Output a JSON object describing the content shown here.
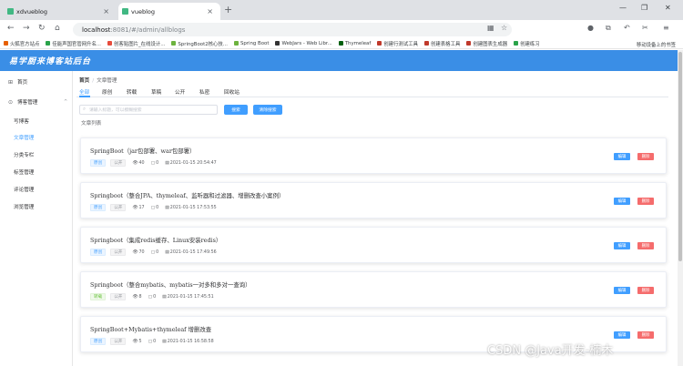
{
  "browser": {
    "tabs": [
      {
        "title": "xdvueblog",
        "active": false
      },
      {
        "title": "vueblog",
        "active": true
      }
    ],
    "url_host": "localhost",
    "url_path": ":8081/#/admin/allblogs",
    "bookmarks": [
      {
        "label": "火狐官方站点",
        "color": "#e66000"
      },
      {
        "label": "佳能声国官管网升名...",
        "color": "#2aa34a"
      },
      {
        "label": "创客贴图片_在线设计...",
        "color": "#e74c3c"
      },
      {
        "label": "SpringBoot2核心技...",
        "color": "#6db33f"
      },
      {
        "label": "Spring Boot",
        "color": "#6db33f"
      },
      {
        "label": "WebJars - Web Libr...",
        "color": "#333333"
      },
      {
        "label": "Thymeleaf",
        "color": "#005f0f"
      },
      {
        "label": "创建行测试工具",
        "color": "#c0392b"
      },
      {
        "label": "创建表格工具",
        "color": "#c0392b"
      },
      {
        "label": "创建图表生成器",
        "color": "#c0392b"
      },
      {
        "label": "创建练习",
        "color": "#2aa34a"
      }
    ],
    "bookmark_end": "移动设备上的书签"
  },
  "app": {
    "logo": "易学厨来博客站后台"
  },
  "sidebar": {
    "items": [
      {
        "label": "首页",
        "icon": "grid-icon",
        "glyph": "⊞",
        "type": "top"
      },
      {
        "label": "博客管理",
        "icon": "location-icon",
        "glyph": "⊙",
        "type": "group"
      },
      {
        "label": "写博客",
        "type": "sub",
        "active": false
      },
      {
        "label": "文章管理",
        "type": "sub",
        "active": true
      },
      {
        "label": "分类专栏",
        "type": "sub",
        "active": false
      },
      {
        "label": "标签管理",
        "type": "sub",
        "active": false
      },
      {
        "label": "评论管理",
        "type": "sub",
        "active": false
      },
      {
        "label": "浏览管理",
        "type": "sub",
        "active": false
      }
    ]
  },
  "breadcrumb": {
    "home": "首页",
    "separator": "/",
    "current": "文章管理"
  },
  "tabs": [
    "全部",
    "原创",
    "转载",
    "草稿",
    "公开",
    "私密",
    "回收站"
  ],
  "search": {
    "placeholder": "请输入标题，可以模糊搜索",
    "search_button": "搜索",
    "clear_button": "清除搜索"
  },
  "list_title": "文章列表",
  "edit_label": "编辑",
  "delete_label": "删除",
  "articles": [
    {
      "title": "SpringBoot（jar包部署、war包部署）",
      "category": "原创",
      "visibility": "公开",
      "views": "40",
      "comments": "0",
      "date": "2021-01-15 20:54:47"
    },
    {
      "title": "Springboot（整合JPA、thymeleaf、监听器和过滤器、增删改查小案例）",
      "category": "原创",
      "visibility": "公开",
      "views": "17",
      "comments": "0",
      "date": "2021-01-15 17:53:55"
    },
    {
      "title": "Springboot（集成redis缓存、Linux安装redis）",
      "category": "原创",
      "visibility": "公开",
      "views": "70",
      "comments": "0",
      "date": "2021-01-15 17:49:56"
    },
    {
      "title": "Springboot（整合mybatis、mybatis一对多和多对一查询）",
      "category": "转载",
      "visibility": "公开",
      "views": "8",
      "comments": "0",
      "date": "2021-01-15 17:45:51"
    },
    {
      "title": "SpringBoot+Mybatis+thymeleaf 增删改查",
      "category": "原创",
      "visibility": "公开",
      "views": "5",
      "comments": "0",
      "date": "2021-01-15 16:58:58"
    }
  ],
  "watermark": "CSDN @Java开发-楠木"
}
